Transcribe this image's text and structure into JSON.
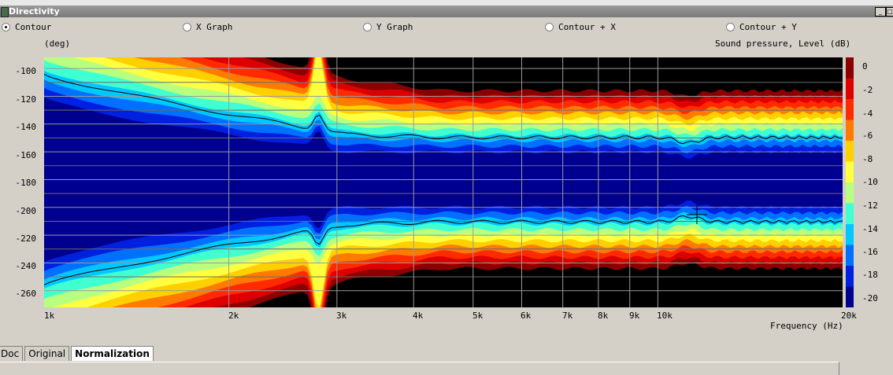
{
  "window": {
    "title": "Directivity"
  },
  "view_options": [
    {
      "label": "Contour",
      "selected": true
    },
    {
      "label": "X Graph",
      "selected": false
    },
    {
      "label": "Y Graph",
      "selected": false
    },
    {
      "label": "Contour + X",
      "selected": false
    },
    {
      "label": "Contour + Y",
      "selected": false
    }
  ],
  "plot": {
    "y_unit": "(deg)",
    "colorbar_title": "Sound pressure, Level  (dB)",
    "x_title": "Frequency  (Hz)",
    "y_ticks": [
      "-100",
      "-120",
      "-140",
      "-160",
      "-180",
      "-200",
      "-220",
      "-240",
      "-260"
    ],
    "x_ticks": [
      "1k",
      "2k",
      "3k",
      "4k",
      "5k",
      "6k",
      "7k",
      "8k",
      "9k",
      "10k",
      "20k"
    ],
    "colorbar_ticks": [
      "0",
      "-2",
      "-4",
      "-6",
      "-8",
      "-10",
      "-12",
      "-14",
      "-16",
      "-18",
      "-20"
    ]
  },
  "colors": {
    "levels": [
      "#8b0000",
      "#dd0000",
      "#ff2a00",
      "#ff7a00",
      "#ffd000",
      "#ffff40",
      "#b8ff80",
      "#40ffd0",
      "#00c8ff",
      "#0070ff",
      "#0020e0",
      "#000090",
      "#000000"
    ]
  },
  "tabs": [
    {
      "label": "Doc",
      "active": false
    },
    {
      "label": "Original",
      "active": false
    },
    {
      "label": "Normalization",
      "active": true
    }
  ]
}
